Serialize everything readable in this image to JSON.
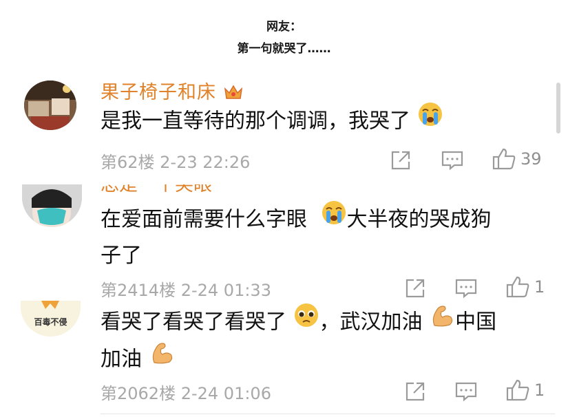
{
  "header": {
    "line1": "网友：",
    "line2": "第一句就哭了……"
  },
  "comments": [
    {
      "username": "果子椅子和床",
      "text": "是我一直等待的那个调调，我哭了",
      "floor": "第62楼 2-23 22:26",
      "likes": "39"
    },
    {
      "username": "总是一个笑眼",
      "text_a": "在爱面前需要什么字眼",
      "text_b": "大半夜的哭成狗",
      "text_c": "子了",
      "floor": "第2414楼 2-24 01:33",
      "likes": "1"
    },
    {
      "avatar_text": "百毒不侵",
      "text_a": "看哭了看哭了看哭了",
      "text_b": "，武汉加油",
      "text_c": "中国",
      "text_d": "加油",
      "floor": "第2062楼 2-24 01:06",
      "likes": "1"
    }
  ],
  "colors": {
    "username": "#e0822a",
    "meta": "#a8a8a8",
    "icon": "#9a9a9a"
  }
}
